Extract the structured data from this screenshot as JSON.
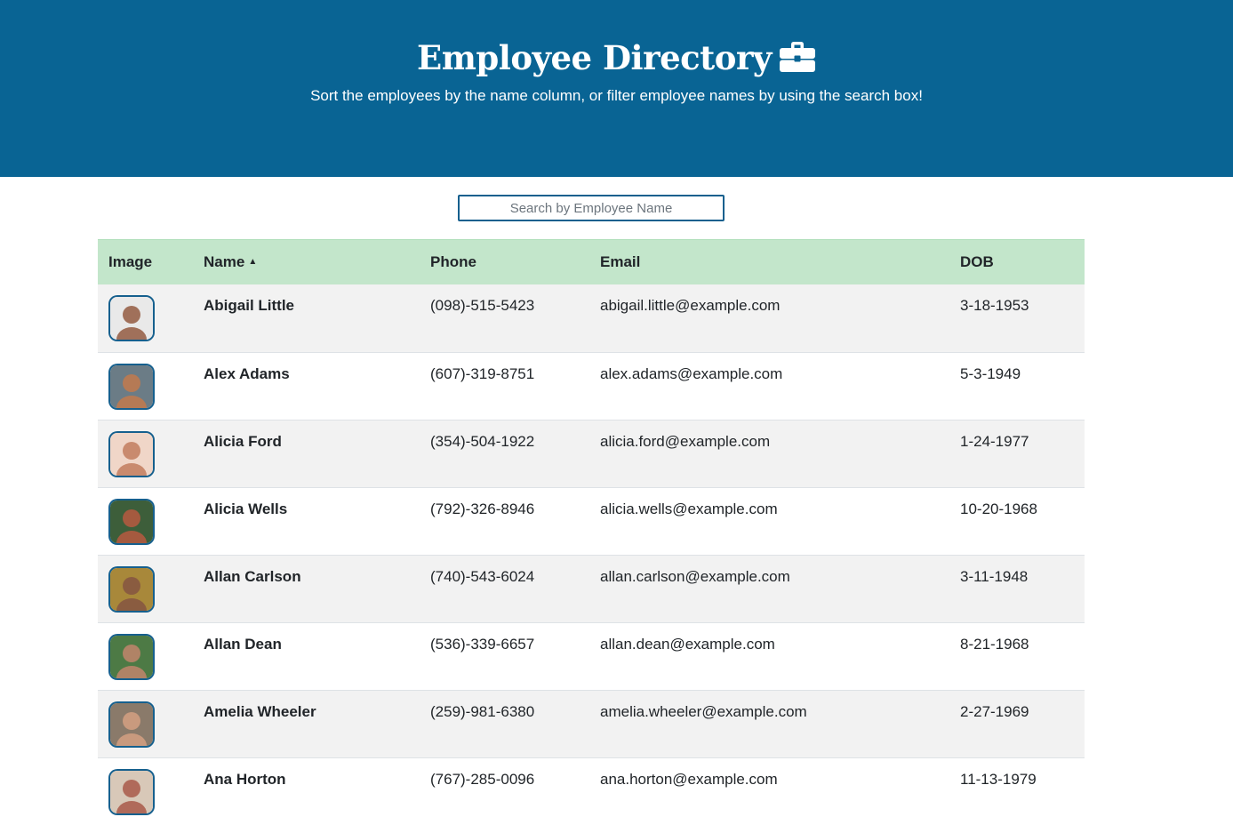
{
  "header": {
    "title": "Employee Directory",
    "title_icon": "briefcase-icon",
    "subtitle": "Sort the employees by the name column, or filter employee names by using the search box!",
    "background_color": "#096494"
  },
  "search": {
    "placeholder": "Search by Employee Name",
    "value": ""
  },
  "table": {
    "header_color": "#c3e6cb",
    "columns": [
      "Image",
      "Name",
      "Phone",
      "Email",
      "DOB"
    ],
    "sort": {
      "column": "Name",
      "direction": "ascending",
      "icon": "caret-up-icon"
    },
    "rows": [
      {
        "name": "Abigail Little",
        "phone": "(098)-515-5423",
        "email": "abigail.little@example.com",
        "dob": "3-18-1953",
        "avatar_bg": "#e9e9e9",
        "avatar_fg": "#a0705a"
      },
      {
        "name": "Alex Adams",
        "phone": "(607)-319-8751",
        "email": "alex.adams@example.com",
        "dob": "5-3-1949",
        "avatar_bg": "#6b7c86",
        "avatar_fg": "#b57a55"
      },
      {
        "name": "Alicia Ford",
        "phone": "(354)-504-1922",
        "email": "alicia.ford@example.com",
        "dob": "1-24-1977",
        "avatar_bg": "#f0d6c8",
        "avatar_fg": "#c98a6e"
      },
      {
        "name": "Alicia Wells",
        "phone": "(792)-326-8946",
        "email": "alicia.wells@example.com",
        "dob": "10-20-1968",
        "avatar_bg": "#3d5e3a",
        "avatar_fg": "#a55a3f"
      },
      {
        "name": "Allan Carlson",
        "phone": "(740)-543-6024",
        "email": "allan.carlson@example.com",
        "dob": "3-11-1948",
        "avatar_bg": "#a8883a",
        "avatar_fg": "#8a5c40"
      },
      {
        "name": "Allan Dean",
        "phone": "(536)-339-6657",
        "email": "allan.dean@example.com",
        "dob": "8-21-1968",
        "avatar_bg": "#4d7a45",
        "avatar_fg": "#b08366"
      },
      {
        "name": "Amelia Wheeler",
        "phone": "(259)-981-6380",
        "email": "amelia.wheeler@example.com",
        "dob": "2-27-1969",
        "avatar_bg": "#8a7a6a",
        "avatar_fg": "#c99a7e"
      },
      {
        "name": "Ana Horton",
        "phone": "(767)-285-0096",
        "email": "ana.horton@example.com",
        "dob": "11-13-1979",
        "avatar_bg": "#d8c8b8",
        "avatar_fg": "#b06a5a"
      }
    ]
  }
}
